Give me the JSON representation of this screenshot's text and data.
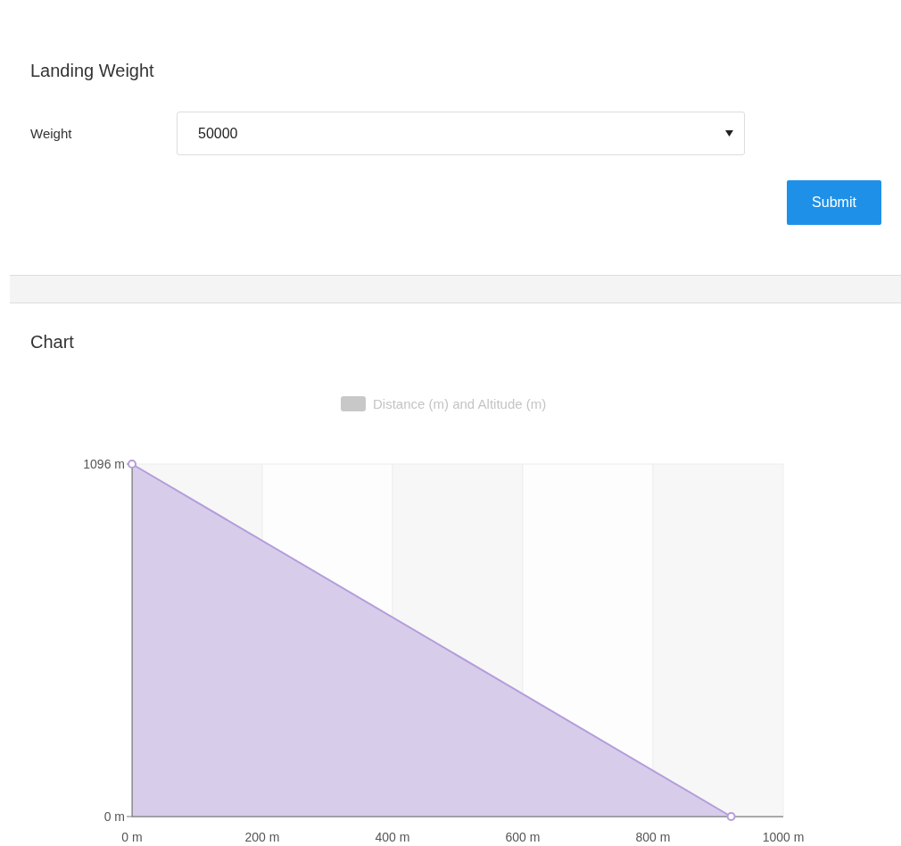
{
  "form": {
    "title": "Landing Weight",
    "weight_label": "Weight",
    "weight_value": "50000",
    "submit": "Submit"
  },
  "chart_section": {
    "title": "Chart",
    "chart_data": {
      "type": "area",
      "series": [
        {
          "name": "Distance (m) and Altitude (m)",
          "color": "#b39ddb",
          "values": [
            1096,
            0
          ]
        }
      ],
      "x": [
        0,
        920
      ],
      "xlim": [
        0,
        1000
      ],
      "ylim": [
        0,
        1096
      ],
      "xticks": [
        {
          "value": 0,
          "label": "0 m"
        },
        {
          "value": 200,
          "label": "200 m"
        },
        {
          "value": 400,
          "label": "400 m"
        },
        {
          "value": 600,
          "label": "600 m"
        },
        {
          "value": 800,
          "label": "800 m"
        },
        {
          "value": 1000,
          "label": "1000 m"
        }
      ],
      "yticks": [
        {
          "value": 0,
          "label": "0 m"
        },
        {
          "value": 1096,
          "label": "1096 m"
        }
      ]
    }
  }
}
